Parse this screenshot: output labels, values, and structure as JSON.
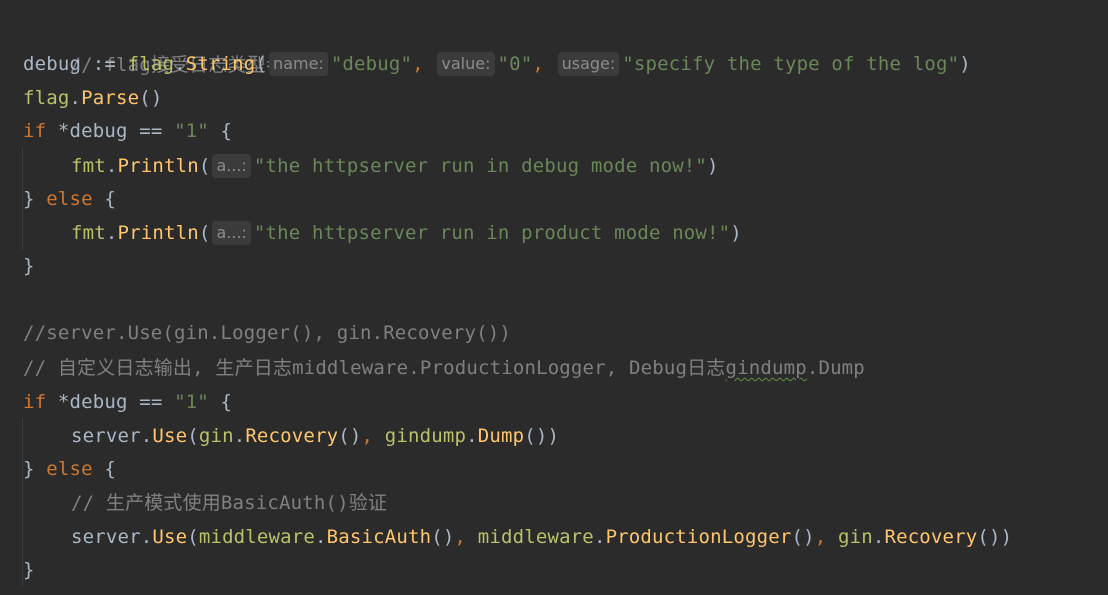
{
  "code": {
    "line1": {
      "comment": "// flag接受日志类型参数"
    },
    "line2": {
      "var": "debug",
      "op": " := ",
      "pkg": "flag",
      "dot": ".",
      "func": "String",
      "open": "(",
      "hint_name": "name:",
      "arg_name": "\"debug\"",
      "sep1": ", ",
      "hint_value": "value:",
      "arg_value": "\"0\"",
      "sep2": ", ",
      "hint_usage": "usage:",
      "arg_usage": "\"specify the type of the log\"",
      "close": ")"
    },
    "line3": {
      "pkg": "flag",
      "dot": ".",
      "func": "Parse",
      "parens": "()"
    },
    "line4": {
      "kw": "if",
      "cond": " *debug == ",
      "val": "\"1\"",
      "brace": " {"
    },
    "line5": {
      "pkg": "fmt",
      "dot": ".",
      "func": "Println",
      "open": "(",
      "hint": "a...:",
      "arg": "\"the httpserver run in debug mode now!\"",
      "close": ")"
    },
    "line6": {
      "close": "} ",
      "kw": "else",
      "brace": " {"
    },
    "line7": {
      "pkg": "fmt",
      "dot": ".",
      "func": "Println",
      "open": "(",
      "hint": "a...:",
      "arg": "\"the httpserver run in product mode now!\"",
      "close": ")"
    },
    "line8": {
      "brace": "}"
    },
    "line9": {
      "comment": "//server.Use(gin.Logger(), gin.Recovery())"
    },
    "line10": {
      "comment_a": "// 自定义日志输出, 生产日志middleware.ProductionLogger, Debug日志",
      "comment_typo": "gindump",
      "comment_b": ".Dump"
    },
    "line11": {
      "kw": "if",
      "cond": " *debug == ",
      "val": "\"1\"",
      "brace": " {"
    },
    "line12": {
      "obj": "server",
      "dot1": ".",
      "func": "Use",
      "open": "(",
      "pkg1": "gin",
      "dot2": ".",
      "func2": "Recovery",
      "p1": "()",
      "sep": ", ",
      "pkg2": "gindump",
      "dot3": ".",
      "func3": "Dump",
      "p2": "())"
    },
    "line13": {
      "close": "} ",
      "kw": "else",
      "brace": " {"
    },
    "line14": {
      "comment": "// 生产模式使用BasicAuth()验证"
    },
    "line15": {
      "obj": "server",
      "dot1": ".",
      "func": "Use",
      "open": "(",
      "pkg1": "middleware",
      "dot2": ".",
      "func2": "BasicAuth",
      "p1": "()",
      "sep1": ", ",
      "pkg2": "middleware",
      "dot3": ".",
      "func3": "ProductionLogger",
      "p2": "()",
      "sep2": ", ",
      "pkg3": "gin",
      "dot4": ".",
      "func4": "Recovery",
      "p3": "())"
    },
    "line16": {
      "brace": "}"
    }
  },
  "colors": {
    "background": "#2b2b2b",
    "default_text": "#a9b7c6",
    "comment": "#808080",
    "keyword": "#cc7832",
    "string": "#6a8759",
    "function": "#ffc66d",
    "package": "#bcc069",
    "inlay_hint_bg": "#3b3b3b",
    "inlay_hint_text": "#8c8c8c"
  }
}
